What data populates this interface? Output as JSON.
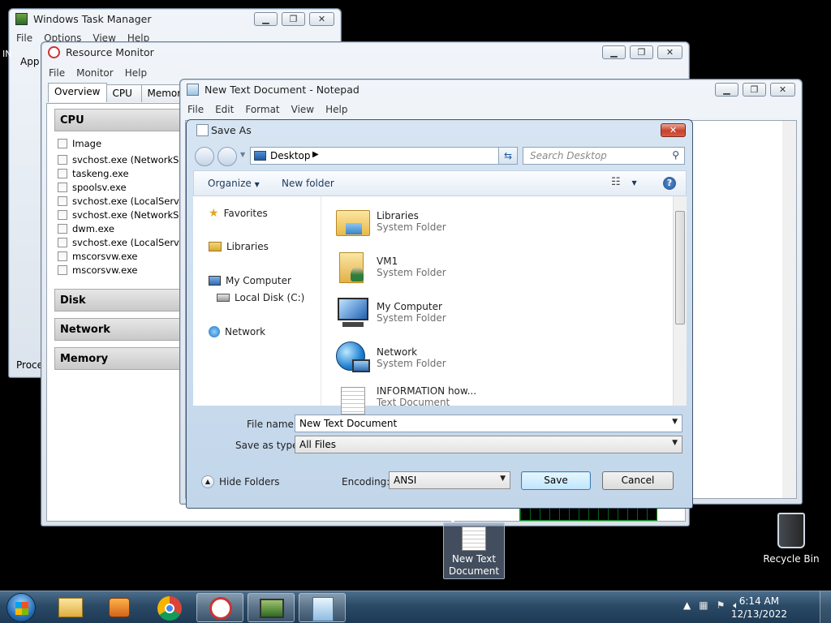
{
  "task_manager": {
    "title": "Windows Task Manager",
    "menu": [
      "File",
      "Options",
      "View",
      "Help"
    ],
    "tab_fragment": "App",
    "status_fragment": "Proce",
    "left_fragment": "IN"
  },
  "resource_monitor": {
    "title": "Resource Monitor",
    "menu": [
      "File",
      "Monitor",
      "Help"
    ],
    "tabs": [
      "Overview",
      "CPU",
      "Memory"
    ],
    "sections": [
      "CPU",
      "Disk",
      "Network",
      "Memory"
    ],
    "column_header": "Image",
    "processes": [
      "svchost.exe (NetworkService",
      "taskeng.exe",
      "spoolsv.exe",
      "svchost.exe (LocalServiceNo",
      "svchost.exe (NetworkServic",
      "dwm.exe",
      "svchost.exe (LocalServiceAn",
      "mscorsvw.exe",
      "mscorsvw.exe"
    ]
  },
  "notepad": {
    "title": "New Text Document - Notepad",
    "menu": [
      "File",
      "Edit",
      "Format",
      "View",
      "Help"
    ]
  },
  "save_as": {
    "title": "Save As",
    "address": "Desktop",
    "search_placeholder": "Search Desktop",
    "toolbar": {
      "organize": "Organize",
      "new_folder": "New folder"
    },
    "nav": {
      "favorites": "Favorites",
      "libraries": "Libraries",
      "my_computer": "My Computer",
      "local_disk": "Local Disk (C:)",
      "network": "Network"
    },
    "files": [
      {
        "name": "Libraries",
        "type": "System Folder",
        "icon": "libraries-folder-icon"
      },
      {
        "name": "VM1",
        "type": "System Folder",
        "icon": "user-folder-icon"
      },
      {
        "name": "My Computer",
        "type": "System Folder",
        "icon": "computer-icon"
      },
      {
        "name": "Network",
        "type": "System Folder",
        "icon": "network-globe-icon"
      },
      {
        "name": "INFORMATION how...",
        "type": "Text Document",
        "icon": "text-document-icon"
      }
    ],
    "file_name_label": "File name:",
    "file_name_value": "New Text Document",
    "save_as_type_label": "Save as type:",
    "save_as_type_value": "All Files",
    "hide_folders": "Hide Folders",
    "encoding_label": "Encoding:",
    "encoding_value": "ANSI",
    "save_label": "Save",
    "cancel_label": "Cancel"
  },
  "desktop": {
    "dragged_icon_label": "New Text Document",
    "recycle_bin_label": "Recycle Bin"
  },
  "taskbar": {
    "time": "6:14 AM",
    "date": "12/13/2022"
  },
  "colors": {
    "desktop": "#000000",
    "taskbar": "#2a4a66",
    "close_button": "#c8412c",
    "link_text": "#1e395b"
  }
}
